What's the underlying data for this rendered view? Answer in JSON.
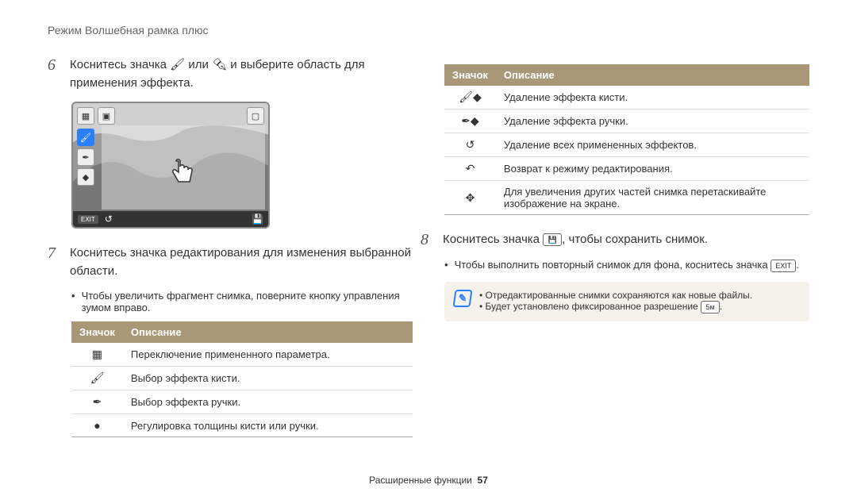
{
  "header": "Режим Волшебная рамка плюс",
  "step6": {
    "num": "6",
    "prefix": "Коснитесь значка ",
    "mid": " или ",
    "suffix": " и выберите область для применения эффекта."
  },
  "screenshot": {
    "exit": "EXIT"
  },
  "step7": {
    "num": "7",
    "text": "Коснитесь значка редактирования для изменения выбранной области."
  },
  "bullet7": "Чтобы увеличить фрагмент снимка, поверните кнопку управления зумом вправо.",
  "table_headers": {
    "icon": "Значок",
    "desc": "Описание"
  },
  "table1": [
    {
      "icon": "▦",
      "desc": "Переключение примененного параметра."
    },
    {
      "icon": "🖌",
      "desc": "Выбор эффекта кисти."
    },
    {
      "icon": "✒",
      "desc": "Выбор эффекта ручки."
    },
    {
      "icon": "●",
      "desc": "Регулировка толщины кисти или ручки."
    }
  ],
  "table2": [
    {
      "icon": "🖌◆",
      "desc": "Удаление эффекта кисти."
    },
    {
      "icon": "✒◆",
      "desc": "Удаление эффекта ручки."
    },
    {
      "icon": "↺",
      "desc": "Удаление всех примененных эффектов."
    },
    {
      "icon": "↶",
      "desc": "Возврат к режиму редактирования."
    },
    {
      "icon": "✥",
      "desc": "Для увеличения других частей снимка перетаскивайте изображение на экране."
    }
  ],
  "step8": {
    "num": "8",
    "prefix": "Коснитесь значка ",
    "suffix": ", чтобы сохранить снимок."
  },
  "bullet8": {
    "prefix": "Чтобы выполнить повторный снимок для фона, коснитесь значка ",
    "btn": "EXIT"
  },
  "note": {
    "line1": "Отредактированные снимки сохраняются как новые файлы.",
    "line2_prefix": "Будет установлено фиксированное разрешение ",
    "line2_badge": "5ᴍ"
  },
  "footer": {
    "section": "Расширенные функции",
    "page": "57"
  }
}
